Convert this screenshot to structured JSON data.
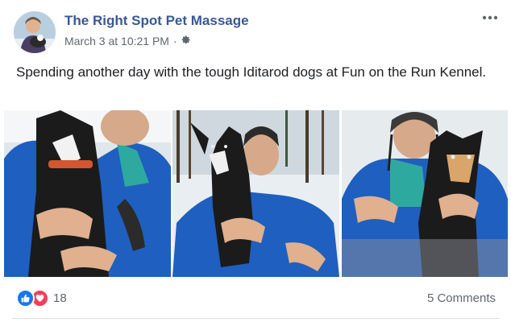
{
  "post": {
    "page_name": "The Right Spot Pet Massage",
    "timestamp": "March 3 at 10:21 PM",
    "separator": "·",
    "audience_icon": "gear-icon",
    "text": "Spending another day with the tough Iditarod dogs at Fun on the Run Kennel."
  },
  "photos": [
    {
      "name": "photo-1",
      "subject": "person in blue jacket hugging black and white husky"
    },
    {
      "name": "photo-2",
      "subject": "dog sitting on lap in snowy forest"
    },
    {
      "name": "photo-3",
      "subject": "smiling person in knit hat with husky"
    }
  ],
  "footer": {
    "reaction_icons": [
      "like-icon",
      "love-icon"
    ],
    "reaction_count": "18",
    "comments_label": "5 Comments"
  },
  "colors": {
    "link": "#385898",
    "muted": "#606770",
    "like": "#1877f2",
    "love": "#f33e58",
    "jacket": "#1f5fbf"
  }
}
